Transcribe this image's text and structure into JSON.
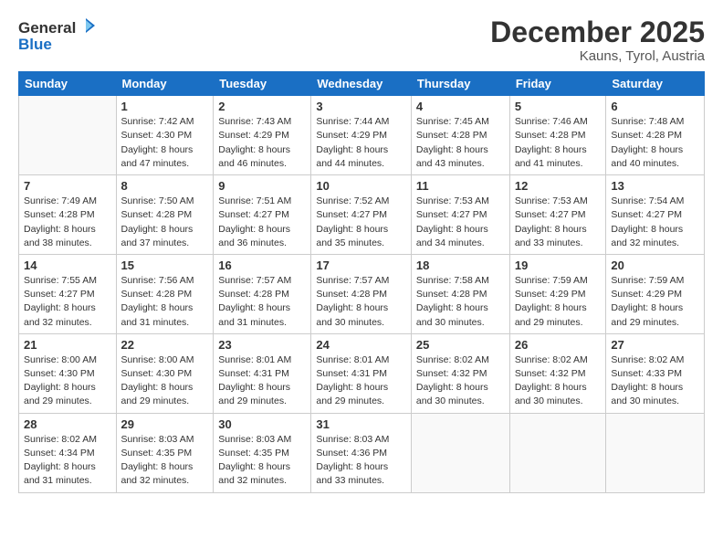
{
  "logo": {
    "line1": "General",
    "line2": "Blue"
  },
  "title": "December 2025",
  "location": "Kauns, Tyrol, Austria",
  "weekdays": [
    "Sunday",
    "Monday",
    "Tuesday",
    "Wednesday",
    "Thursday",
    "Friday",
    "Saturday"
  ],
  "weeks": [
    [
      {
        "num": "",
        "info": ""
      },
      {
        "num": "1",
        "info": "Sunrise: 7:42 AM\nSunset: 4:30 PM\nDaylight: 8 hours\nand 47 minutes."
      },
      {
        "num": "2",
        "info": "Sunrise: 7:43 AM\nSunset: 4:29 PM\nDaylight: 8 hours\nand 46 minutes."
      },
      {
        "num": "3",
        "info": "Sunrise: 7:44 AM\nSunset: 4:29 PM\nDaylight: 8 hours\nand 44 minutes."
      },
      {
        "num": "4",
        "info": "Sunrise: 7:45 AM\nSunset: 4:28 PM\nDaylight: 8 hours\nand 43 minutes."
      },
      {
        "num": "5",
        "info": "Sunrise: 7:46 AM\nSunset: 4:28 PM\nDaylight: 8 hours\nand 41 minutes."
      },
      {
        "num": "6",
        "info": "Sunrise: 7:48 AM\nSunset: 4:28 PM\nDaylight: 8 hours\nand 40 minutes."
      }
    ],
    [
      {
        "num": "7",
        "info": "Sunrise: 7:49 AM\nSunset: 4:28 PM\nDaylight: 8 hours\nand 38 minutes."
      },
      {
        "num": "8",
        "info": "Sunrise: 7:50 AM\nSunset: 4:28 PM\nDaylight: 8 hours\nand 37 minutes."
      },
      {
        "num": "9",
        "info": "Sunrise: 7:51 AM\nSunset: 4:27 PM\nDaylight: 8 hours\nand 36 minutes."
      },
      {
        "num": "10",
        "info": "Sunrise: 7:52 AM\nSunset: 4:27 PM\nDaylight: 8 hours\nand 35 minutes."
      },
      {
        "num": "11",
        "info": "Sunrise: 7:53 AM\nSunset: 4:27 PM\nDaylight: 8 hours\nand 34 minutes."
      },
      {
        "num": "12",
        "info": "Sunrise: 7:53 AM\nSunset: 4:27 PM\nDaylight: 8 hours\nand 33 minutes."
      },
      {
        "num": "13",
        "info": "Sunrise: 7:54 AM\nSunset: 4:27 PM\nDaylight: 8 hours\nand 32 minutes."
      }
    ],
    [
      {
        "num": "14",
        "info": "Sunrise: 7:55 AM\nSunset: 4:27 PM\nDaylight: 8 hours\nand 32 minutes."
      },
      {
        "num": "15",
        "info": "Sunrise: 7:56 AM\nSunset: 4:28 PM\nDaylight: 8 hours\nand 31 minutes."
      },
      {
        "num": "16",
        "info": "Sunrise: 7:57 AM\nSunset: 4:28 PM\nDaylight: 8 hours\nand 31 minutes."
      },
      {
        "num": "17",
        "info": "Sunrise: 7:57 AM\nSunset: 4:28 PM\nDaylight: 8 hours\nand 30 minutes."
      },
      {
        "num": "18",
        "info": "Sunrise: 7:58 AM\nSunset: 4:28 PM\nDaylight: 8 hours\nand 30 minutes."
      },
      {
        "num": "19",
        "info": "Sunrise: 7:59 AM\nSunset: 4:29 PM\nDaylight: 8 hours\nand 29 minutes."
      },
      {
        "num": "20",
        "info": "Sunrise: 7:59 AM\nSunset: 4:29 PM\nDaylight: 8 hours\nand 29 minutes."
      }
    ],
    [
      {
        "num": "21",
        "info": "Sunrise: 8:00 AM\nSunset: 4:30 PM\nDaylight: 8 hours\nand 29 minutes."
      },
      {
        "num": "22",
        "info": "Sunrise: 8:00 AM\nSunset: 4:30 PM\nDaylight: 8 hours\nand 29 minutes."
      },
      {
        "num": "23",
        "info": "Sunrise: 8:01 AM\nSunset: 4:31 PM\nDaylight: 8 hours\nand 29 minutes."
      },
      {
        "num": "24",
        "info": "Sunrise: 8:01 AM\nSunset: 4:31 PM\nDaylight: 8 hours\nand 29 minutes."
      },
      {
        "num": "25",
        "info": "Sunrise: 8:02 AM\nSunset: 4:32 PM\nDaylight: 8 hours\nand 30 minutes."
      },
      {
        "num": "26",
        "info": "Sunrise: 8:02 AM\nSunset: 4:32 PM\nDaylight: 8 hours\nand 30 minutes."
      },
      {
        "num": "27",
        "info": "Sunrise: 8:02 AM\nSunset: 4:33 PM\nDaylight: 8 hours\nand 30 minutes."
      }
    ],
    [
      {
        "num": "28",
        "info": "Sunrise: 8:02 AM\nSunset: 4:34 PM\nDaylight: 8 hours\nand 31 minutes."
      },
      {
        "num": "29",
        "info": "Sunrise: 8:03 AM\nSunset: 4:35 PM\nDaylight: 8 hours\nand 32 minutes."
      },
      {
        "num": "30",
        "info": "Sunrise: 8:03 AM\nSunset: 4:35 PM\nDaylight: 8 hours\nand 32 minutes."
      },
      {
        "num": "31",
        "info": "Sunrise: 8:03 AM\nSunset: 4:36 PM\nDaylight: 8 hours\nand 33 minutes."
      },
      {
        "num": "",
        "info": ""
      },
      {
        "num": "",
        "info": ""
      },
      {
        "num": "",
        "info": ""
      }
    ]
  ]
}
